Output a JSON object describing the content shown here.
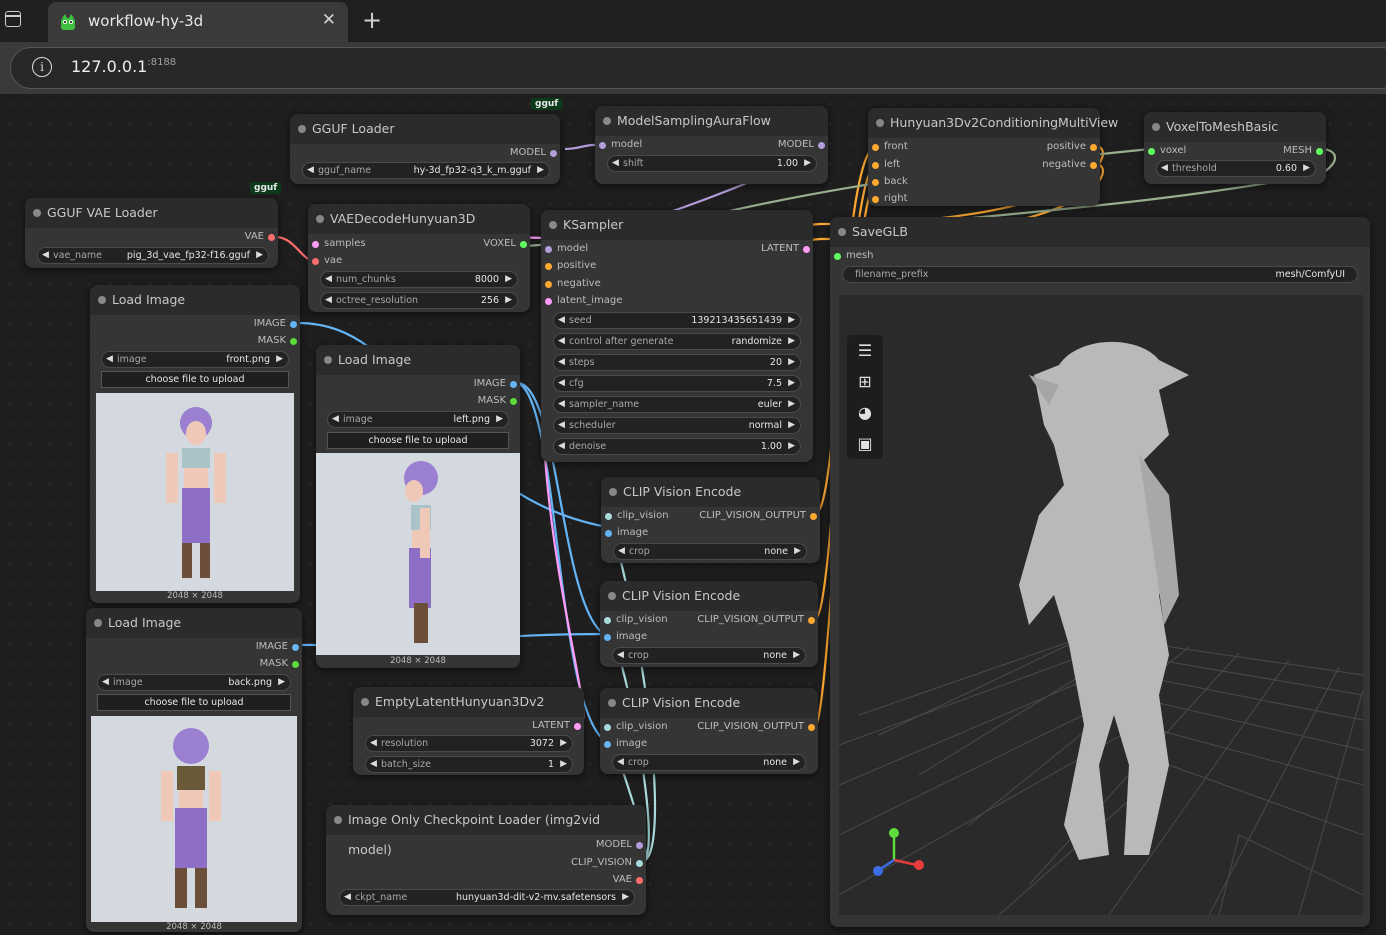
{
  "browser": {
    "tab_title": "workflow-hy-3d",
    "url_host": "127.0.0.1",
    "url_port": ":8188",
    "close_label": "✕",
    "newtab_label": "+"
  },
  "badges": {
    "gguf": "gguf"
  },
  "nodes": {
    "gguf_loader": {
      "title": "GGUF Loader",
      "out_model": "MODEL",
      "w_name_label": "gguf_name",
      "w_name_value": "hy-3d_fp32-q3_k_m.gguf"
    },
    "gguf_vae_loader": {
      "title": "GGUF VAE Loader",
      "out_vae": "VAE",
      "w_name_label": "vae_name",
      "w_name_value": "pig_3d_vae_fp32-f16.gguf"
    },
    "model_sampling": {
      "title": "ModelSamplingAuraFlow",
      "in_model": "model",
      "out_model": "MODEL",
      "w_shift_label": "shift",
      "w_shift_value": "1.00"
    },
    "conditioning": {
      "title": "Hunyuan3Dv2ConditioningMultiView",
      "in_front": "front",
      "in_left": "left",
      "in_back": "back",
      "in_right": "right",
      "out_positive": "positive",
      "out_negative": "negative"
    },
    "voxel_to_mesh": {
      "title": "VoxelToMeshBasic",
      "in_voxel": "voxel",
      "out_mesh": "MESH",
      "w_threshold_label": "threshold",
      "w_threshold_value": "0.60"
    },
    "vae_decode": {
      "title": "VAEDecodeHunyuan3D",
      "in_samples": "samples",
      "in_vae": "vae",
      "out_voxel": "VOXEL",
      "w_chunks_label": "num_chunks",
      "w_chunks_value": "8000",
      "w_octree_label": "octree_resolution",
      "w_octree_value": "256"
    },
    "ksampler": {
      "title": "KSampler",
      "in_model": "model",
      "in_positive": "positive",
      "in_negative": "negative",
      "in_latent": "latent_image",
      "out_latent": "LATENT",
      "widgets": [
        {
          "label": "seed",
          "value": "139213435651439"
        },
        {
          "label": "control after generate",
          "value": "randomize"
        },
        {
          "label": "steps",
          "value": "20"
        },
        {
          "label": "cfg",
          "value": "7.5"
        },
        {
          "label": "sampler_name",
          "value": "euler"
        },
        {
          "label": "scheduler",
          "value": "normal"
        },
        {
          "label": "denoise",
          "value": "1.00"
        }
      ]
    },
    "save_glb": {
      "title": "SaveGLB",
      "in_mesh": "mesh",
      "w_prefix_label": "filename_prefix",
      "w_prefix_value": "mesh/ComfyUI"
    },
    "load_image_1": {
      "title": "Load Image",
      "out_image": "IMAGE",
      "out_mask": "MASK",
      "w_image_label": "image",
      "w_image_value": "front.png",
      "upload_label": "choose file to upload",
      "dims": "2048 × 2048"
    },
    "load_image_2": {
      "title": "Load Image",
      "out_image": "IMAGE",
      "out_mask": "MASK",
      "w_image_label": "image",
      "w_image_value": "left.png",
      "upload_label": "choose file to upload",
      "dims": "2048 × 2048"
    },
    "load_image_3": {
      "title": "Load Image",
      "out_image": "IMAGE",
      "out_mask": "MASK",
      "w_image_label": "image",
      "w_image_value": "back.png",
      "upload_label": "choose file to upload",
      "dims": "2048 × 2048"
    },
    "clip_vision_1": {
      "title": "CLIP Vision Encode",
      "in_clip": "clip_vision",
      "in_image": "image",
      "out": "CLIP_VISION_OUTPUT",
      "w_crop_label": "crop",
      "w_crop_value": "none"
    },
    "clip_vision_2": {
      "title": "CLIP Vision Encode",
      "in_clip": "clip_vision",
      "in_image": "image",
      "out": "CLIP_VISION_OUTPUT",
      "w_crop_label": "crop",
      "w_crop_value": "none"
    },
    "clip_vision_3": {
      "title": "CLIP Vision Encode",
      "in_clip": "clip_vision",
      "in_image": "image",
      "out": "CLIP_VISION_OUTPUT",
      "w_crop_label": "crop",
      "w_crop_value": "none"
    },
    "empty_latent": {
      "title": "EmptyLatentHunyuan3Dv2",
      "out_latent": "LATENT",
      "w_res_label": "resolution",
      "w_res_value": "3072",
      "w_batch_label": "batch_size",
      "w_batch_value": "1"
    },
    "ckpt_loader": {
      "title": "Image Only Checkpoint Loader (img2vid model)",
      "out_model": "MODEL",
      "out_clip": "CLIP_VISION",
      "out_vae": "VAE",
      "w_ckpt_label": "ckpt_name",
      "w_ckpt_value": "hunyuan3d-dit-v2-mv.safetensors"
    }
  },
  "viewer_tools": [
    "menu-icon",
    "grid-icon",
    "palette-icon",
    "image-icon"
  ],
  "colors": {
    "model": "#b39ddb",
    "vae": "#ff6e6e",
    "image": "#64b5f6",
    "clip_vision": "#a8dadc",
    "conditioning": "#ffa931",
    "latent": "#ff9cf9",
    "mesh": "#60ff60",
    "voxel": "#aaaaaa"
  }
}
